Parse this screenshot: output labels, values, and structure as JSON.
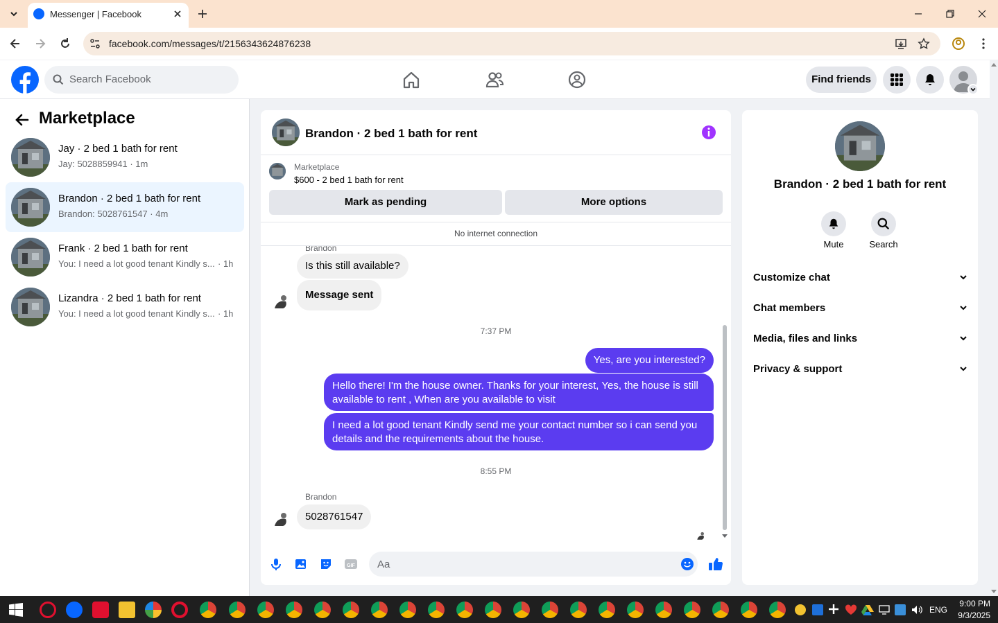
{
  "browser": {
    "tab_title": "Messenger | Facebook",
    "url": "facebook.com/messages/t/2156343624876238"
  },
  "header": {
    "search_placeholder": "Search Facebook",
    "find_friends": "Find friends"
  },
  "left_panel": {
    "title": "Marketplace",
    "conversations": [
      {
        "title": "Jay · 2 bed 1 bath for rent",
        "preview": "Jay: 5028859941 · 1m",
        "active": false
      },
      {
        "title": "Brandon · 2 bed 1 bath for rent",
        "preview": "Brandon: 5028761547 · 4m",
        "active": true
      },
      {
        "title": "Frank · 2 bed 1 bath for rent",
        "preview": "You: I need a lot good tenant Kindly s...",
        "time": "· 1h",
        "active": false
      },
      {
        "title": "Lizandra · 2 bed 1 bath for rent",
        "preview": "You: I need a lot good tenant Kindly s...",
        "time": "· 1h",
        "active": false
      }
    ]
  },
  "chat": {
    "title": "Brandon · 2 bed 1 bath for rent",
    "listing_label": "Marketplace",
    "listing_text": "$600 - 2 bed 1 bath for rent",
    "mark_pending": "Mark as pending",
    "more_options": "More options",
    "status": "No internet connection",
    "sender_name": "Brandon",
    "messages": {
      "m1": "Is this still available?",
      "m2": "Message sent",
      "ts1": "7:37 PM",
      "m3": "Yes, are you interested?",
      "m4": "Hello there! I'm the house owner. Thanks for your interest, Yes, the house is still available to rent , When are you available to visit",
      "m5": "I need a lot good tenant Kindly send me your contact number so i can send you details and the requirements about the house.",
      "ts2": "8:55 PM",
      "sender_name_2": "Brandon",
      "m6": "5028761547"
    },
    "composer_placeholder": "Aa"
  },
  "right_panel": {
    "name": "Brandon · 2 bed 1 bath for rent",
    "mute": "Mute",
    "search": "Search",
    "sections": [
      "Customize chat",
      "Chat members",
      "Media, files and links",
      "Privacy & support"
    ]
  },
  "taskbar": {
    "lang": "ENG",
    "time": "9:00 PM",
    "date": "9/3/2025"
  },
  "colors": {
    "fb_blue": "#0866ff",
    "outgoing_bubble": "#5b3cf0",
    "info_purple": "#a033ff",
    "active_row": "#ebf5ff"
  }
}
